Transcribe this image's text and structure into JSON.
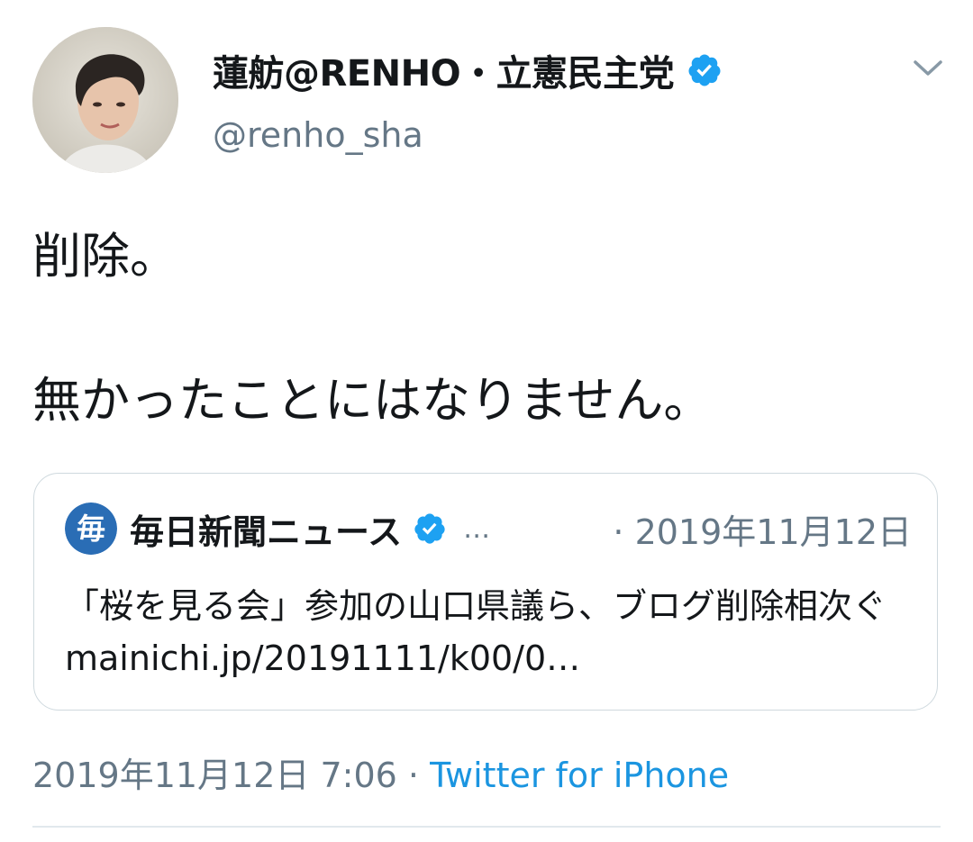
{
  "tweet": {
    "display_name": "蓮舫@RENHO・立憲民主党",
    "handle": "@renho_sha",
    "text": "削除。\n\n無かったことにはなりません。",
    "timestamp": "2019年11月12日 7:06",
    "separator": "·",
    "source": "Twitter for iPhone",
    "menu_icon": "chevron-down-icon"
  },
  "quote": {
    "name": "毎日新聞ニュース",
    "ellipsis": "…",
    "date": "· 2019年11月12日",
    "text": "「桜を見る会」参加の山口県議ら、ブログ削除相次ぐ ",
    "link": "mainichi.jp/20191111/k00/0…",
    "logo_glyph": "毎"
  },
  "colors": {
    "verified": "#1da1f2",
    "link": "#1b95e0",
    "muted": "#657786",
    "mainichi_blue": "#2a6db5"
  }
}
